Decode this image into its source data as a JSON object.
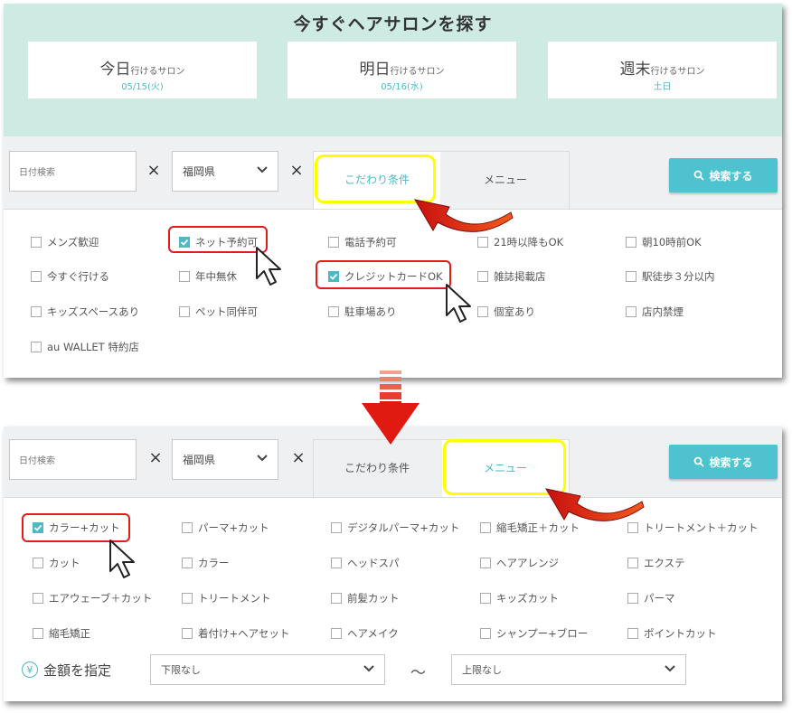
{
  "hero": {
    "title": "今すぐヘアサロンを探す",
    "cards": [
      {
        "main": "今日",
        "sub": "行けるサロン",
        "date": "05/15(火)"
      },
      {
        "main": "明日",
        "sub": "行けるサロン",
        "date": "05/16(水)"
      },
      {
        "main": "週末",
        "sub": "行けるサロン",
        "date": "土日"
      }
    ]
  },
  "search": {
    "date_placeholder": "日付検索",
    "times_symbol": "×",
    "prefecture": "福岡県",
    "tab_conditions": "こだわり条件",
    "tab_menu": "メニュー",
    "search_button": "検索する"
  },
  "conditions": [
    {
      "label": "メンズ歓迎",
      "checked": false
    },
    {
      "label": "ネット予約可",
      "checked": true
    },
    {
      "label": "電話予約可",
      "checked": false
    },
    {
      "label": "21時以降もOK",
      "checked": false
    },
    {
      "label": "朝10時前OK",
      "checked": false
    },
    {
      "label": "今すぐ行ける",
      "checked": false
    },
    {
      "label": "年中無休",
      "checked": false
    },
    {
      "label": "クレジットカードOK",
      "checked": true
    },
    {
      "label": "雑誌掲載店",
      "checked": false
    },
    {
      "label": "駅徒歩３分以内",
      "checked": false
    },
    {
      "label": "キッズスペースあり",
      "checked": false
    },
    {
      "label": "ペット同伴可",
      "checked": false
    },
    {
      "label": "駐車場あり",
      "checked": false
    },
    {
      "label": "個室あり",
      "checked": false
    },
    {
      "label": "店内禁煙",
      "checked": false
    },
    {
      "label": "au WALLET 特約店",
      "checked": false
    }
  ],
  "menus": [
    {
      "label": "カラー+カット",
      "checked": true
    },
    {
      "label": "パーマ+カット",
      "checked": false
    },
    {
      "label": "デジタルパーマ+カット",
      "checked": false
    },
    {
      "label": "縮毛矯正＋カット",
      "checked": false
    },
    {
      "label": "トリートメント＋カット",
      "checked": false
    },
    {
      "label": "カット",
      "checked": false
    },
    {
      "label": "カラー",
      "checked": false
    },
    {
      "label": "ヘッドスパ",
      "checked": false
    },
    {
      "label": "ヘアアレンジ",
      "checked": false
    },
    {
      "label": "エクステ",
      "checked": false
    },
    {
      "label": "エアウェーブ＋カット",
      "checked": false
    },
    {
      "label": "トリートメント",
      "checked": false
    },
    {
      "label": "前髪カット",
      "checked": false
    },
    {
      "label": "キッズカット",
      "checked": false
    },
    {
      "label": "パーマ",
      "checked": false
    },
    {
      "label": "縮毛矯正",
      "checked": false
    },
    {
      "label": "着付け+ヘアセット",
      "checked": false
    },
    {
      "label": "ヘアメイク",
      "checked": false
    },
    {
      "label": "シャンプー+ブロー",
      "checked": false
    },
    {
      "label": "ポイントカット",
      "checked": false
    }
  ],
  "price": {
    "label": "金額を指定",
    "min": "下限なし",
    "tilde": "〜",
    "max": "上限なし"
  },
  "colors": {
    "accent": "#4db8c6",
    "highlight_red": "#e21b1b",
    "highlight_yellow": "#ffff00",
    "hero_bg": "#cdeae3"
  }
}
